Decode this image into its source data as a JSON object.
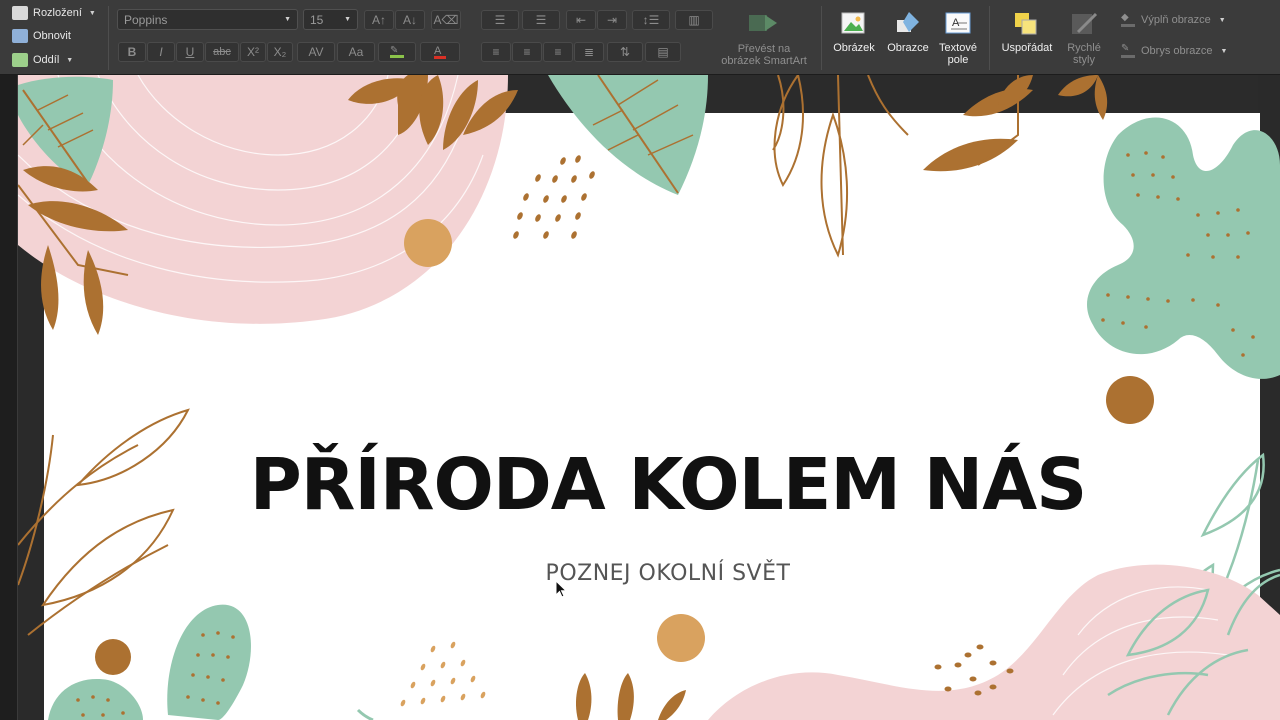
{
  "ribbon": {
    "layout_label": "Rozložení",
    "reset_label": "Obnovit",
    "section_label": "Oddíl",
    "font_name": "Poppins",
    "font_size": "15",
    "smartart_line1": "Převést na",
    "smartart_line2": "obrázek SmartArt",
    "picture_label": "Obrázek",
    "shapes_label": "Obrazce",
    "textbox_line1": "Textové",
    "textbox_line2": "pole",
    "arrange_label": "Uspořádat",
    "quickstyles_line1": "Rychlé",
    "quickstyles_line2": "styly",
    "shape_fill_label": "Výplň obrazce",
    "shape_outline_label": "Obrys obrazce"
  },
  "slide": {
    "title": "PŘÍRODA KOLEM NÁS",
    "subtitle": "POZNEJ OKOLNÍ SVĚT"
  },
  "colors": {
    "pink": "#f2d2d2",
    "sage": "#93c7ae",
    "brown": "#ac7131",
    "sand": "#d9a25f"
  }
}
